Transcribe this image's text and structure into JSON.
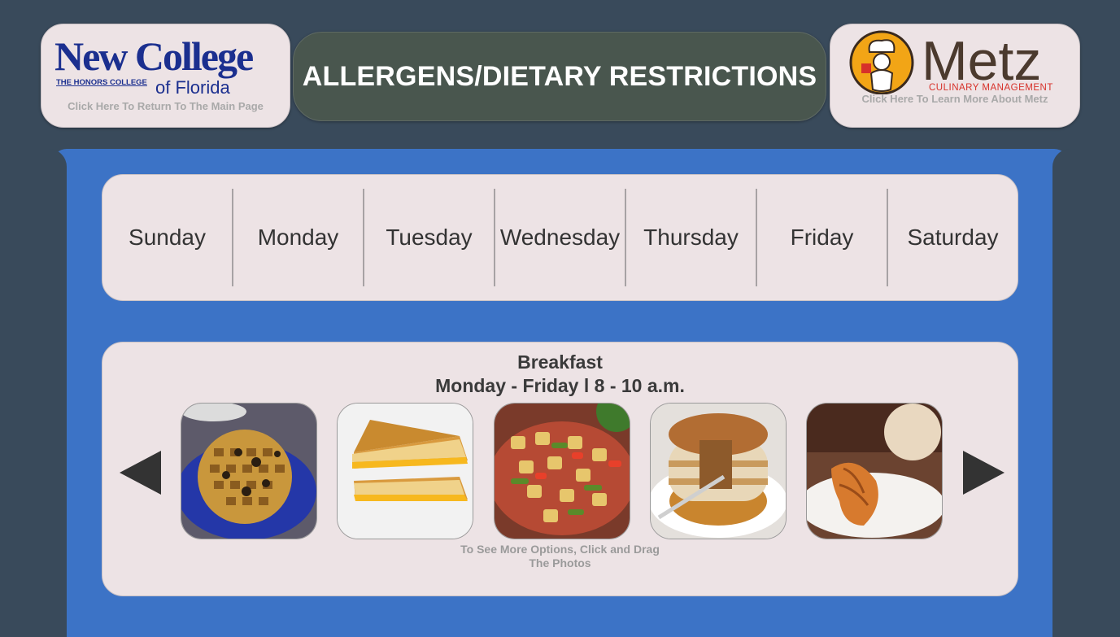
{
  "header": {
    "left_logo": {
      "name_line1": "New College",
      "name_line2": "of Florida",
      "tagline": "THE HONORS COLLEGE",
      "caption": "Click Here To Return To The Main Page"
    },
    "title": "ALLERGENS/DIETARY RESTRICTIONS",
    "right_logo": {
      "name": "Metz",
      "tagline": "CULINARY MANAGEMENT",
      "caption": "Click Here To Learn More About Metz"
    }
  },
  "days": [
    "Sunday",
    "Monday",
    "Tuesday",
    "Wednesday",
    "Thursday",
    "Friday",
    "Saturday"
  ],
  "meal": {
    "title": "Breakfast",
    "hours": "Monday - Friday l 8 - 10 a.m.",
    "hint": "To See More Options, Click and Drag The Photos",
    "photos": [
      "waffle-image",
      "grilled-cheese-image",
      "breakfast-potatoes-image",
      "pancakes-image",
      "croissant-image"
    ]
  },
  "colors": {
    "page_background": "#394a5b",
    "panel_blue": "#3c73c6",
    "card_background": "#ede3e5",
    "title_pill": "#49564e",
    "new_college_blue": "#1b2f8f",
    "metz_brown": "#4b3a2e",
    "metz_red": "#d7312a",
    "metz_gold": "#f2a516"
  }
}
